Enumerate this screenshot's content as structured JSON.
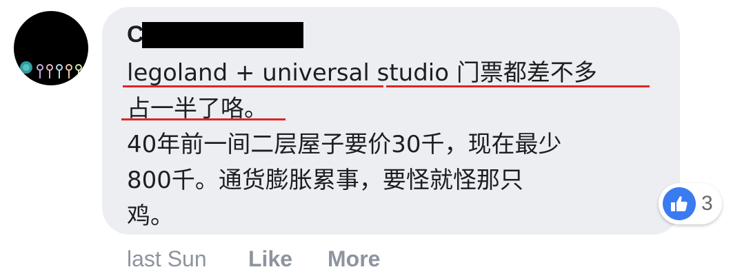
{
  "comment": {
    "author_visible": "C",
    "body_lines": [
      "legoland + universal studio 门票都差不多",
      "占一半了咯。",
      "40年前一间二层屋子要价30千，现在最少",
      "800千。通货膨胀累事，要怪就怪那只",
      "鸡。"
    ],
    "reaction_icon": "thumbs-up-icon",
    "reaction_count": "3",
    "timestamp": "last Sun",
    "like_label": "Like",
    "more_label": "More"
  },
  "colors": {
    "bubble": "#eceef1",
    "underline": "#e02424",
    "like_blue": "#3b7bf0",
    "meta_gray": "#8d949e"
  }
}
